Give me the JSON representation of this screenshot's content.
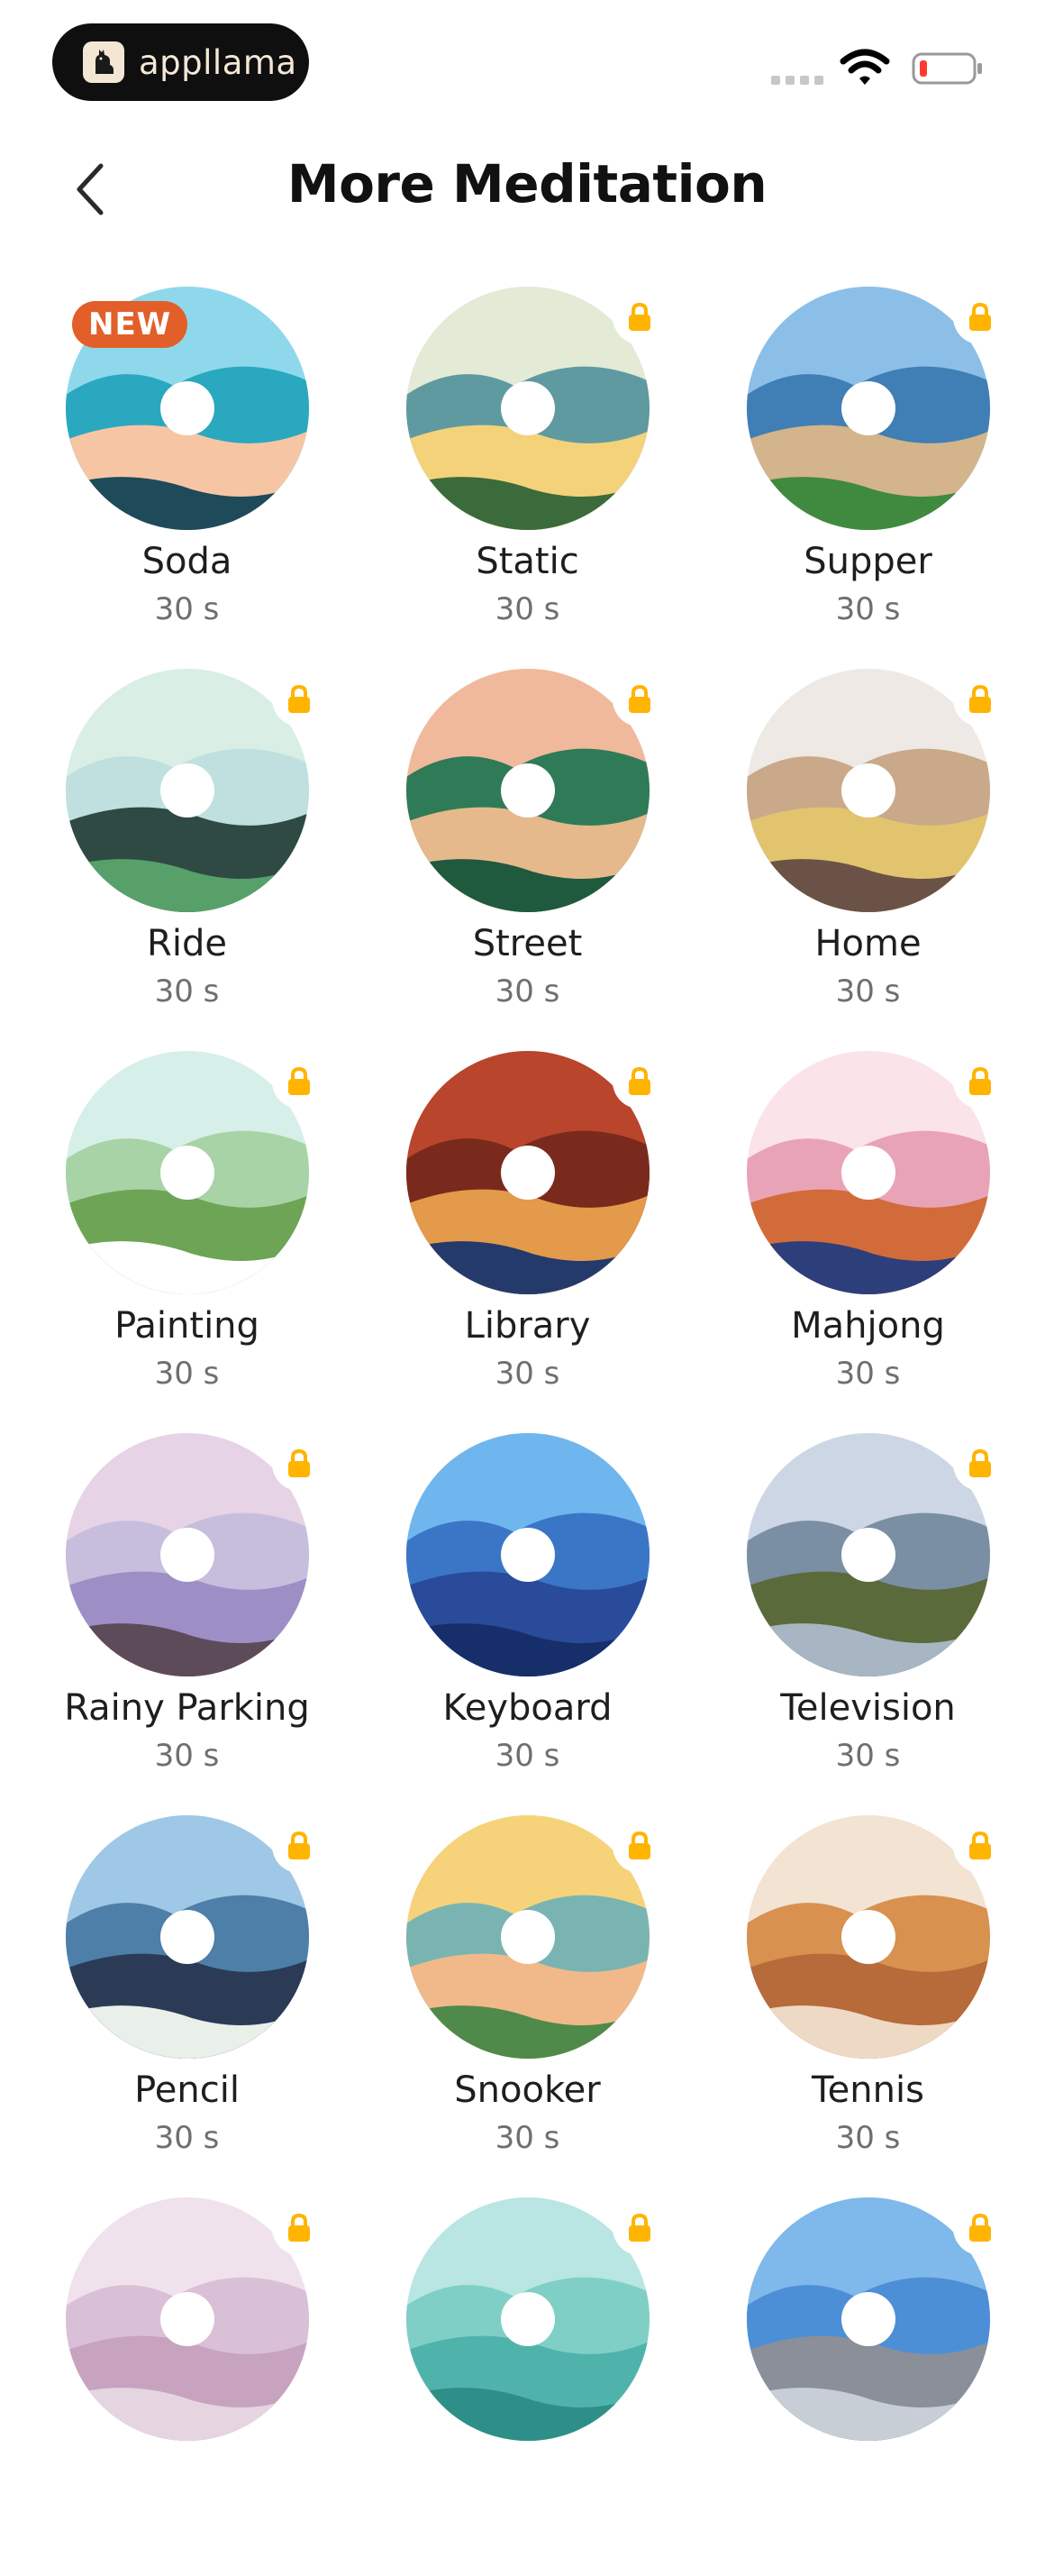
{
  "status_bar": {
    "brand": "appllama",
    "colors": {
      "battery_low": "#ff3b30",
      "pill_bg": "#0f0f0f"
    }
  },
  "header": {
    "title": "More Meditation",
    "back_icon": "chevron-left-icon"
  },
  "badge_new": "NEW",
  "accent": {
    "lock": "#ffb400",
    "new_badge": "#e25f2a"
  },
  "meditations": [
    {
      "name": "Soda",
      "duration": "30 s",
      "locked": false,
      "is_new": true,
      "palette": [
        "#8fd8ec",
        "#2aa8c0",
        "#f6c6a4",
        "#1f4a5a"
      ]
    },
    {
      "name": "Static",
      "duration": "30 s",
      "locked": true,
      "is_new": false,
      "palette": [
        "#e3ead6",
        "#5f9aa0",
        "#f4d27a",
        "#3b6b3a"
      ]
    },
    {
      "name": "Supper",
      "duration": "30 s",
      "locked": true,
      "is_new": false,
      "palette": [
        "#8bbfe8",
        "#3f7fb5",
        "#d4b48a",
        "#3f8a3e"
      ]
    },
    {
      "name": "Ride",
      "duration": "30 s",
      "locked": true,
      "is_new": false,
      "palette": [
        "#d9eee4",
        "#bfe0de",
        "#2f4a43",
        "#58a06a"
      ]
    },
    {
      "name": "Street",
      "duration": "30 s",
      "locked": true,
      "is_new": false,
      "palette": [
        "#f1b99c",
        "#2f7b57",
        "#e6b98c",
        "#1f5a3f"
      ]
    },
    {
      "name": "Home",
      "duration": "30 s",
      "locked": true,
      "is_new": false,
      "palette": [
        "#eee9e4",
        "#c9a98a",
        "#e2c46f",
        "#6a5246"
      ]
    },
    {
      "name": "Painting",
      "duration": "30 s",
      "locked": true,
      "is_new": false,
      "palette": [
        "#d7efe9",
        "#a8d3a6",
        "#6ea455",
        "#ffffff"
      ]
    },
    {
      "name": "Library",
      "duration": "30 s",
      "locked": true,
      "is_new": false,
      "palette": [
        "#b8452c",
        "#7a2a1c",
        "#e39a4a",
        "#243a6a"
      ]
    },
    {
      "name": "Mahjong",
      "duration": "30 s",
      "locked": true,
      "is_new": false,
      "palette": [
        "#fbe3ea",
        "#e8a4b6",
        "#d26b3a",
        "#2c3f7a"
      ]
    },
    {
      "name": "Rainy Parking",
      "duration": "30 s",
      "locked": true,
      "is_new": false,
      "palette": [
        "#e7d3e6",
        "#c7bede",
        "#9d8fc6",
        "#5e4b5a"
      ]
    },
    {
      "name": "Keyboard",
      "duration": "30 s",
      "locked": false,
      "is_new": false,
      "palette": [
        "#6fb6ee",
        "#3b76c6",
        "#2a4b9a",
        "#162f6a"
      ]
    },
    {
      "name": "Television",
      "duration": "30 s",
      "locked": true,
      "is_new": false,
      "palette": [
        "#cdd6e4",
        "#7a8fa4",
        "#5b6a3a",
        "#a7b6c2"
      ]
    },
    {
      "name": "Pencil",
      "duration": "30 s",
      "locked": true,
      "is_new": false,
      "palette": [
        "#9fc8e6",
        "#4d7fa8",
        "#2b3b56",
        "#e9f0ea"
      ]
    },
    {
      "name": "Snooker",
      "duration": "30 s",
      "locked": true,
      "is_new": false,
      "palette": [
        "#f6d37a",
        "#7ab4b2",
        "#f1b98a",
        "#4f8a4a"
      ]
    },
    {
      "name": "Tennis",
      "duration": "30 s",
      "locked": true,
      "is_new": false,
      "palette": [
        "#f3e3d2",
        "#d8914f",
        "#b76a3a",
        "#eed9c4"
      ]
    },
    {
      "name": "",
      "duration": "",
      "locked": true,
      "is_new": false,
      "palette": [
        "#f0e2ec",
        "#d9c0d6",
        "#c7a3c0",
        "#e5d5e0"
      ]
    },
    {
      "name": "",
      "duration": "",
      "locked": true,
      "is_new": false,
      "palette": [
        "#b9e6e2",
        "#7fcfc6",
        "#4fb3ab",
        "#2e8f88"
      ]
    },
    {
      "name": "",
      "duration": "",
      "locked": true,
      "is_new": false,
      "palette": [
        "#7fb8ea",
        "#4d8fd6",
        "#8a8f9a",
        "#c7ced6"
      ]
    }
  ]
}
